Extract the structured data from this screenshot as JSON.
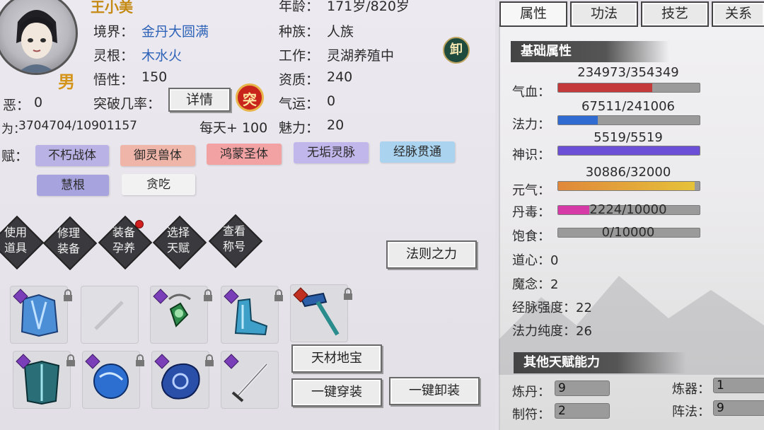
{
  "character": {
    "name": "王小美",
    "gender": "男",
    "realm_label": "境界：",
    "realm_value": "金丹大圆满",
    "root_label": "灵根：",
    "root_value": "木水火",
    "comprehension_label": "悟性：",
    "comprehension_value": "150",
    "breakthrough_label": "突破几率：",
    "detail_button": "详情",
    "breakthrough_seal": "突",
    "evil_label": "恶：",
    "evil_value": "0",
    "cultivation_label": "为：",
    "cultivation_value": "3704704/10901157",
    "daily_gain": "每天+ 100",
    "age_label": "年龄：",
    "age_value": "171岁/820岁",
    "race_label": "种族：",
    "race_value": "人族",
    "job_label": "工作：",
    "job_value": "灵湖养殖中",
    "unequip_seal": "卸",
    "aptitude_label": "资质：",
    "aptitude_value": "240",
    "luck_label": "气运：",
    "luck_value": "0",
    "charm_label": "魅力：",
    "charm_value": "20",
    "talent_label": "赋："
  },
  "talents": [
    {
      "label": "不朽战体",
      "color": "#b9b2e4"
    },
    {
      "label": "御灵兽体",
      "color": "#efb5a8"
    },
    {
      "label": "鸿蒙圣体",
      "color": "#f2a2a2"
    },
    {
      "label": "无垢灵脉",
      "color": "#c2b7ea"
    },
    {
      "label": "经脉贯通",
      "color": "#a9d3ef"
    },
    {
      "label": "慧根",
      "color": "#a7a3de"
    },
    {
      "label": "贪吃",
      "color": "#f2f2f2"
    }
  ],
  "actions": [
    {
      "line1": "使用",
      "line2": "道具",
      "icon": "use-item"
    },
    {
      "line1": "修理",
      "line2": "装备",
      "icon": "repair"
    },
    {
      "line1": "装备",
      "line2": "孕养",
      "icon": "nurture",
      "badge": true
    },
    {
      "line1": "选择",
      "line2": "天赋",
      "icon": "choose-talent"
    },
    {
      "line1": "查看",
      "line2": "称号",
      "icon": "view-title"
    }
  ],
  "law_button": "法则之力",
  "treasure_button": "天材地宝",
  "equip_all_button": "一键穿装",
  "unequip_all_button": "一键卸装",
  "equipment_slots": [
    {
      "item": "robe-icon",
      "rank": "极"
    },
    {
      "item": "empty-slot-icon",
      "rank": ""
    },
    {
      "item": "pendant-icon",
      "rank": "极"
    },
    {
      "item": "boots-icon",
      "rank": "极"
    },
    {
      "item": "hammer-icon",
      "rank": "极"
    },
    {
      "item": "armor-icon",
      "rank": "极"
    },
    {
      "item": "orb-icon",
      "rank": "极"
    },
    {
      "item": "ring-stone-icon",
      "rank": "极"
    },
    {
      "item": "sword-icon",
      "rank": "极"
    }
  ],
  "tabs": [
    "属性",
    "功法",
    "技艺",
    "关系"
  ],
  "basic_section": "基础属性",
  "bars": [
    {
      "label": "气血：",
      "text": "234973/354349",
      "fraction": 0.663,
      "color": "#c43a3a"
    },
    {
      "label": "法力：",
      "text": "67511/241006",
      "fraction": 0.28,
      "color": "#2f6bd0"
    },
    {
      "label": "神识：",
      "text": "5519/5519",
      "fraction": 1.0,
      "color": "#6b4fd6"
    },
    {
      "label": "元气：",
      "text": "30886/32000",
      "fraction": 0.965,
      "color": "#e09a3a"
    },
    {
      "label": "丹毒：",
      "text": "2224/10000",
      "fraction": 0.222,
      "color": "#d63aa6"
    },
    {
      "label": "饱食：",
      "text": "0/10000",
      "fraction": 0.0,
      "color": "#9a9a9a"
    }
  ],
  "stats": [
    {
      "label": "道心：",
      "value": "0"
    },
    {
      "label": "魔念：",
      "value": "2"
    },
    {
      "label": "经脉强度：",
      "value": "22"
    },
    {
      "label": "法力纯度：",
      "value": "26"
    }
  ],
  "other_section": "其他天赋能力",
  "abilities": [
    {
      "label": "炼丹：",
      "value": "9"
    },
    {
      "label": "炼器：",
      "value": "1"
    },
    {
      "label": "制符：",
      "value": "2"
    },
    {
      "label": "阵法：",
      "value": "9"
    }
  ]
}
